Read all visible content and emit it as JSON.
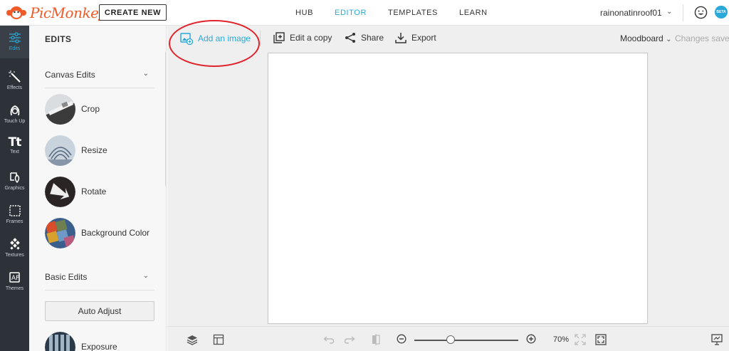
{
  "topbar": {
    "logo_text": "PicMonkey",
    "create_new": "CREATE NEW",
    "nav": [
      "HUB",
      "EDITOR",
      "TEMPLATES",
      "LEARN"
    ],
    "active_nav": "EDITOR",
    "username": "rainonatinroof01",
    "beta_badge": "BETA"
  },
  "rail": {
    "items": [
      {
        "label": "Edits",
        "icon": "sliders-icon",
        "active": true
      },
      {
        "label": "Effects",
        "icon": "magic-wand-icon"
      },
      {
        "label": "Touch Up",
        "icon": "face-icon"
      },
      {
        "label": "Text",
        "icon": "text-tt-icon",
        "glyph": "Tt"
      },
      {
        "label": "Graphics",
        "icon": "shapes-icon"
      },
      {
        "label": "Frames",
        "icon": "frame-icon"
      },
      {
        "label": "Textures",
        "icon": "texture-icon"
      },
      {
        "label": "Themes",
        "icon": "themes-icon"
      }
    ]
  },
  "panel": {
    "title": "EDITS",
    "section_canvas": "Canvas Edits",
    "tools": [
      {
        "label": "Crop"
      },
      {
        "label": "Resize"
      },
      {
        "label": "Rotate"
      },
      {
        "label": "Background Color"
      }
    ],
    "section_basic": "Basic Edits",
    "auto_adjust": "Auto Adjust",
    "exposure": "Exposure"
  },
  "toolbar": {
    "add_image": "Add an image",
    "edit_copy": "Edit a copy",
    "share": "Share",
    "export": "Export",
    "moodboard": "Moodboard",
    "changes_saved": "Changes saved"
  },
  "bottombar": {
    "zoom": "70%",
    "zoom_level": 0.35
  },
  "colors": {
    "accent": "#2aa8d8",
    "brand": "#f05a28",
    "rail": "#2d3238",
    "annotation": "#e0242c"
  }
}
